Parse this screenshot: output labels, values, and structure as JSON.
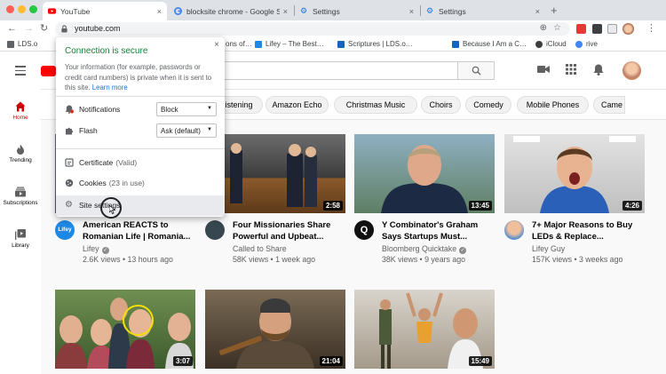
{
  "browser": {
    "tabs": [
      {
        "title": "YouTube",
        "active": true,
        "icon": "youtube-icon"
      },
      {
        "title": "blocksite chrome - Google Sea",
        "active": false,
        "icon": "google-icon"
      },
      {
        "title": "Settings",
        "active": false,
        "icon": "gear-icon"
      },
      {
        "title": "Settings",
        "active": false,
        "icon": "gear-icon"
      }
    ],
    "new_tab_label": "+",
    "url": "youtube.com",
    "bookmarks": [
      {
        "label": "LDS.o"
      },
      {
        "label": "ons of…"
      },
      {
        "label": "Lifey – The Best…"
      },
      {
        "label": "Scriptures | LDS.o…"
      },
      {
        "label": "Because I Am a C…"
      },
      {
        "label": "iCloud"
      },
      {
        "label": "rive"
      }
    ]
  },
  "site_info_popup": {
    "title": "Connection is secure",
    "description": "Your information (for example, passwords or credit card numbers) is private when it is sent to this site.",
    "learn_more": "Learn more",
    "permissions": [
      {
        "label": "Notifications",
        "value": "Block",
        "icon": "bell-icon"
      },
      {
        "label": "Flash",
        "value": "Ask (default)",
        "icon": "puzzle-icon"
      }
    ],
    "items": [
      {
        "label": "Certificate",
        "sub": "(Valid)",
        "icon": "certificate-icon"
      },
      {
        "label": "Cookies",
        "sub": "(23 in use)",
        "icon": "cookie-icon"
      },
      {
        "label": "Site settings",
        "sub": "",
        "icon": "gear-icon"
      }
    ],
    "close": "×"
  },
  "youtube": {
    "sidebar": [
      {
        "label": "Home",
        "icon": "home-icon",
        "active": true
      },
      {
        "label": "Trending",
        "icon": "flame-icon",
        "active": false
      },
      {
        "label": "Subscriptions",
        "icon": "subscriptions-icon",
        "active": false
      },
      {
        "label": "Library",
        "icon": "library-icon",
        "active": false
      }
    ],
    "chips": [
      "istening",
      "Amazon Echo",
      "Christmas Music",
      "Choirs",
      "Comedy",
      "Mobile Phones",
      "Came"
    ],
    "videos": [
      {
        "title": "American REACTS to Romanian Life | Romania...",
        "channel": "Lifey",
        "verified": true,
        "views": "2.6K views",
        "age": "13 hours ago",
        "duration": "",
        "avatar_color": "#1e88e5",
        "avatar_text": "Lifey"
      },
      {
        "title": "Four Missionaries Share Powerful and Upbeat...",
        "channel": "Called to Share",
        "verified": false,
        "views": "58K views",
        "age": "1 week ago",
        "duration": "2:58",
        "avatar_color": "#37474f",
        "avatar_text": ""
      },
      {
        "title": "Y Combinator's Graham Says Startups Must...",
        "channel": "Bloomberg Quicktake",
        "verified": true,
        "views": "38K views",
        "age": "9 years ago",
        "duration": "13:45",
        "avatar_color": "#111111",
        "avatar_text": "Q"
      },
      {
        "title": "7+ Major Reasons to Buy LEDs & Replace...",
        "channel": "Lifey Guy",
        "verified": false,
        "views": "157K views",
        "age": "3 weeks ago",
        "duration": "4:26",
        "avatar_color": "#c98a5e",
        "avatar_text": ""
      },
      {
        "title": "",
        "channel": "",
        "verified": false,
        "views": "",
        "age": "",
        "duration": "3:07",
        "avatar_color": "",
        "avatar_text": ""
      },
      {
        "title": "",
        "channel": "",
        "verified": false,
        "views": "",
        "age": "",
        "duration": "21:04",
        "avatar_color": "",
        "avatar_text": ""
      },
      {
        "title": "",
        "channel": "",
        "verified": false,
        "views": "",
        "age": "",
        "duration": "15:49",
        "avatar_color": "",
        "avatar_text": ""
      }
    ]
  },
  "colors": {
    "secure_green": "#188038",
    "link_blue": "#1a73e8",
    "yt_red": "#ff0000"
  }
}
